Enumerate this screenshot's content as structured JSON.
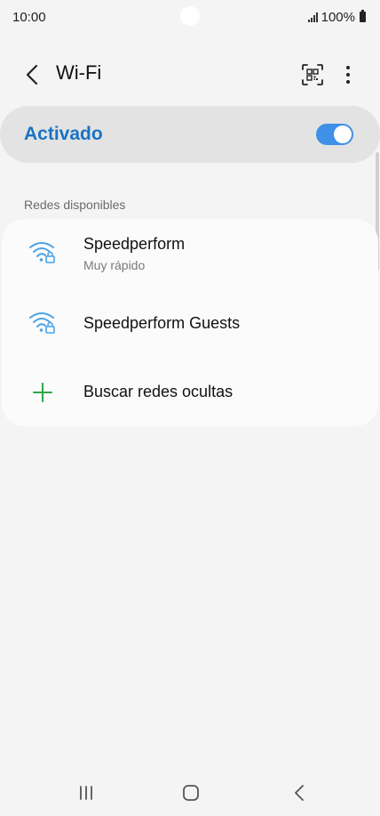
{
  "status_bar": {
    "time": "10:00",
    "battery": "100%",
    "icons": [
      "signal-icon",
      "battery-icon"
    ]
  },
  "header": {
    "title": "Wi-Fi",
    "icons": [
      "back-arrow-icon",
      "qr-code-icon",
      "more-options-icon"
    ]
  },
  "master_switch": {
    "label": "Activado",
    "state": "on"
  },
  "section": {
    "label": "Redes disponibles"
  },
  "networks": [
    {
      "name": "Speedperform",
      "status": "Muy rápido",
      "icon": "wifi-locked-icon"
    },
    {
      "name": "Speedperform Guests",
      "status": "",
      "icon": "wifi-locked-icon"
    }
  ],
  "hidden": {
    "label": "Buscar redes ocultas",
    "icon": "plus-icon"
  },
  "nav_bar": {
    "icons": [
      "recent-apps-icon",
      "home-icon",
      "back-icon"
    ]
  },
  "colors": {
    "accent": "#1a73c4",
    "toggle": "#3e91e6",
    "wifi_icon": "#4aa3e8",
    "plus": "#2ea54b",
    "background": "#f4f4f4"
  }
}
